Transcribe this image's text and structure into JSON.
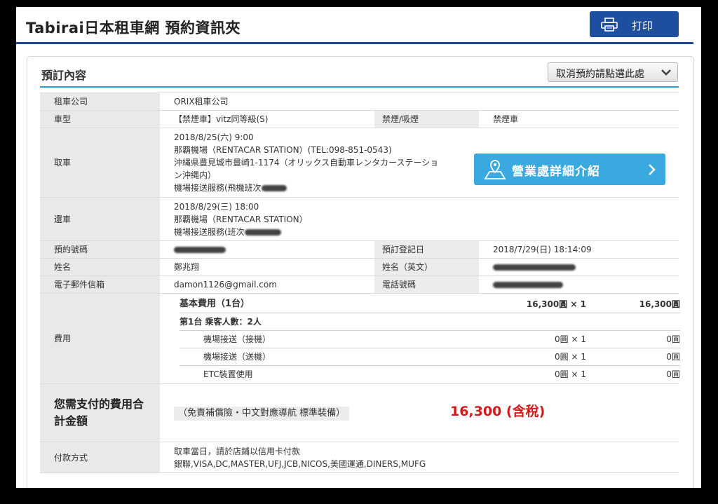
{
  "header": {
    "title": "Tabirai日本租車網 預約資訊夾",
    "print_label": "打印"
  },
  "card": {
    "title": "預訂內容",
    "cancel_label": "取消預約請點選此處"
  },
  "rows": {
    "company": {
      "label": "租車公司",
      "value": "ORIX租車公司"
    },
    "car": {
      "label": "車型",
      "value": "【禁煙車】vitz同等級(S)",
      "smoke_label": "禁煙/吸煙",
      "smoke_value": "禁煙車"
    },
    "pickup": {
      "label": "取車",
      "line1": "2018/8/25(六) 9:00",
      "line2": "那覇機場（RENTACAR STATION）(TEL:098-851-0543)",
      "line3": "沖縄県豊見城市豊崎1-1174（オリックス自動車レンタカーステーショ",
      "line4": "ン沖縄内）",
      "line5": "機場接送服務(飛機班次"
    },
    "return": {
      "label": "還車",
      "line1": "2018/8/29(三) 18:00",
      "line2": "那覇機場（RENTACAR STATION）",
      "line3": "機場接送服務(班次"
    },
    "booking": {
      "label": "預約號碼",
      "reg_label": "預訂登記日",
      "reg_value": "2018/7/29(日) 18:14:09"
    },
    "name": {
      "label": "姓名",
      "value": "鄭兆翔",
      "en_label": "姓名（英文）"
    },
    "email": {
      "label": "電子郵件信箱",
      "value": "damon1126@gmail.com",
      "phone_label": "電話號碼"
    },
    "fee": {
      "label": "費用",
      "basic": {
        "name": "基本費用（1台）",
        "unit": "16,300圓 × 1",
        "total": "16,300圓"
      },
      "passengers": "第1台 乘客人數：2人",
      "items": [
        {
          "name": "機場接送（接機）",
          "unit": "0圓 × 1",
          "total": "0圓"
        },
        {
          "name": "機場接送（送機）",
          "unit": "0圓 × 1",
          "total": "0圓"
        },
        {
          "name": "ETC裝置使用",
          "unit": "0圓 × 1",
          "total": "0圓"
        }
      ]
    },
    "total": {
      "label_line1": "您需支付的費用合",
      "label_line2": "計金額",
      "note": "（免責補償險・中文對應導航 標準裝備）",
      "value": "16,300 (含稅)"
    },
    "payment": {
      "label": "付款方式",
      "line1": "取車當日，請於店鋪以信用卡付款",
      "line2": "銀聯,VISA,DC,MASTER,UFJ,JCB,NICOS,美國運通,DINERS,MUFG"
    }
  },
  "store_button": {
    "label": "營業處詳細介紹"
  },
  "colors": {
    "accent_blue": "#1e4f9e",
    "light_blue": "#3aa9df",
    "total_red": "#d21a1a",
    "label_bg": "#e9e9e9"
  }
}
